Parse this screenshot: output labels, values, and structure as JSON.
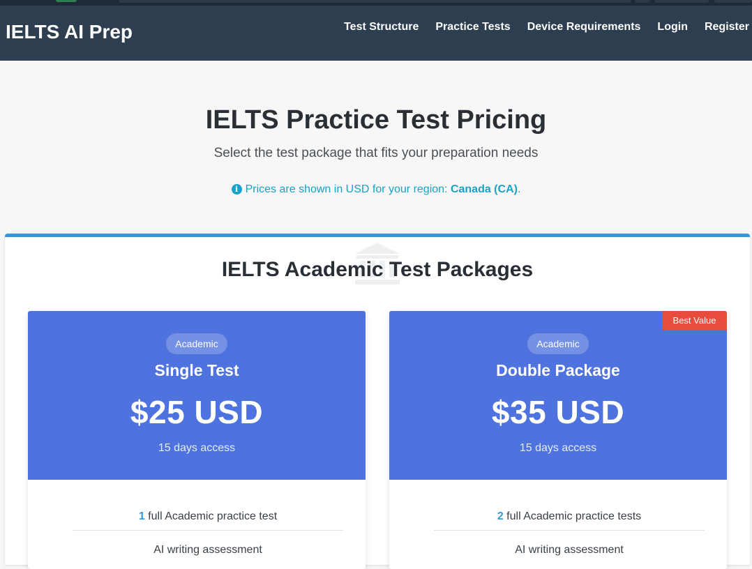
{
  "navbar": {
    "brand": "IELTS AI Prep",
    "links": [
      "Test Structure",
      "Practice Tests",
      "Device Requirements",
      "Login",
      "Register"
    ]
  },
  "hero": {
    "title": "IELTS Practice Test Pricing",
    "subtitle": "Select the test package that fits your preparation needs",
    "region_prefix": "Prices are shown in USD for your region: ",
    "region_name": "Canada (CA)",
    "region_suffix": ".",
    "info_icon": "info-circle-icon"
  },
  "section": {
    "title": "IELTS Academic Test Packages",
    "watermark_icon": "university-icon"
  },
  "packages": [
    {
      "badge": "Academic",
      "title": "Single Test",
      "price": "$25 USD",
      "access": "15 days access",
      "ribbon": "",
      "feature_count": "1",
      "feature_text": " full Academic practice test",
      "feature_2": "AI writing assessment"
    },
    {
      "badge": "Academic",
      "title": "Double Package",
      "price": "$35 USD",
      "access": "15 days access",
      "ribbon": "Best Value",
      "feature_count": "2",
      "feature_text": " full Academic practice tests",
      "feature_2": "AI writing assessment"
    }
  ],
  "colors": {
    "navbar": "#2c3e50",
    "card_header": "#4f73de",
    "accent": "#3498db",
    "info": "#17a2c8",
    "ribbon": "#e74c3c"
  }
}
